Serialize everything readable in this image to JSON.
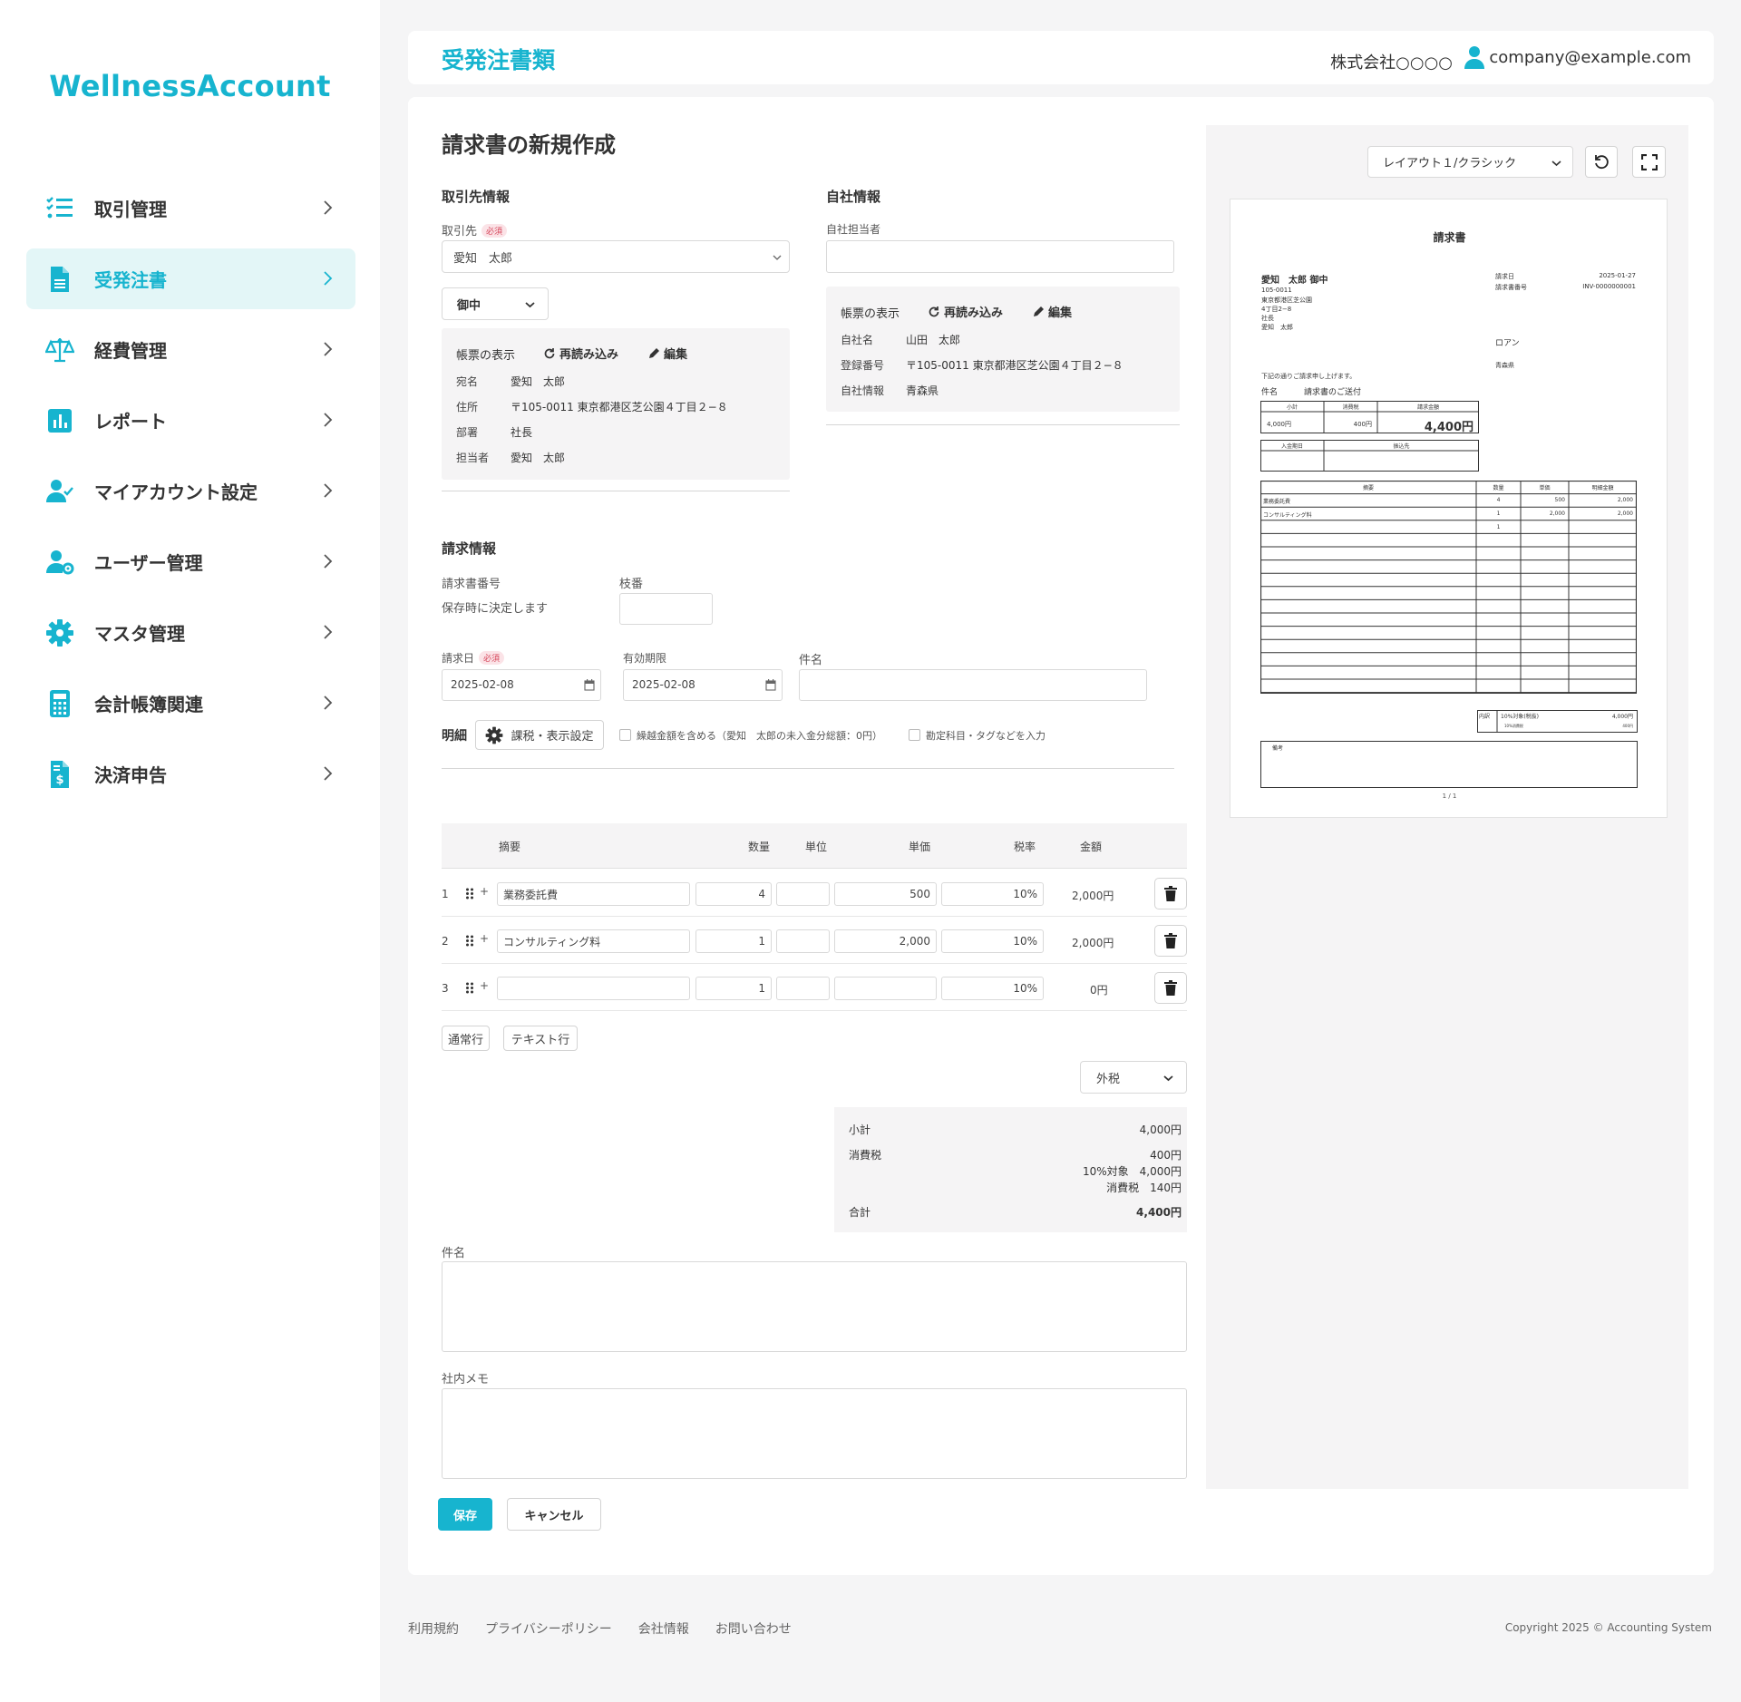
{
  "brand": {
    "name": "WellnessAccount",
    "accent": "#17b4cf"
  },
  "sidebar": {
    "items": [
      {
        "label": "取引管理",
        "icon": "list-check-icon",
        "active": false
      },
      {
        "label": "受発注書",
        "icon": "document-icon",
        "active": true
      },
      {
        "label": "経費管理",
        "icon": "scale-icon",
        "active": false
      },
      {
        "label": "レポート",
        "icon": "bar-chart-icon",
        "active": false
      },
      {
        "label": "マイアカウント設定",
        "icon": "user-check-icon",
        "active": false
      },
      {
        "label": "ユーザー管理",
        "icon": "user-gear-icon",
        "active": false
      },
      {
        "label": "マスタ管理",
        "icon": "gear-icon",
        "active": false
      },
      {
        "label": "会計帳簿関連",
        "icon": "calculator-icon",
        "active": false
      },
      {
        "label": "決済申告",
        "icon": "invoice-dollar-icon",
        "active": false
      }
    ]
  },
  "header": {
    "title": "受発注書類",
    "company": "株式会社○○○○",
    "email": "company@example.com"
  },
  "form": {
    "title": "請求書の新規作成",
    "client": {
      "section": "取引先情報",
      "label": "取引先",
      "required": "必須",
      "value": "愛知　太郎",
      "honorific": "御中",
      "display_label": "帳票の表示",
      "reload": "再読み込み",
      "edit": "編集",
      "rows": [
        {
          "k": "宛名",
          "v": "愛知　太郎"
        },
        {
          "k": "住所",
          "v": "〒105-0011 東京都港区芝公園４丁目２−８"
        },
        {
          "k": "部署",
          "v": "社長"
        },
        {
          "k": "担当者",
          "v": "愛知　太郎"
        }
      ]
    },
    "own": {
      "section": "自社情報",
      "staff_label": "自社担当者",
      "staff_value": "",
      "display_label": "帳票の表示",
      "reload": "再読み込み",
      "edit": "編集",
      "rows": [
        {
          "k": "自社名",
          "v": "山田　太郎"
        },
        {
          "k": "登録番号",
          "v": "〒105-0011 東京都港区芝公園４丁目２−８"
        },
        {
          "k": "自社情報",
          "v": "青森県"
        }
      ]
    },
    "billing": {
      "section": "請求情報",
      "number_label": "請求書番号",
      "number_note": "保存時に決定します",
      "branch_label": "枝番",
      "branch_value": "",
      "date_label": "請求日",
      "date_required": "必須",
      "date_value": "2025-02-08",
      "expiry_label": "有効期限",
      "expiry_value": "2025-02-08",
      "subject_label": "件名",
      "subject_value": ""
    },
    "details": {
      "label": "明細",
      "settings_button": "課税・表示設定",
      "carry_over": "繰越金額を含める（愛知　太郎の未入金分総額：0円）",
      "account_tags": "勘定科目・タグなどを入力",
      "columns": [
        "摘要",
        "数量",
        "単位",
        "単価",
        "税率",
        "金額"
      ],
      "rows": [
        {
          "no": "1",
          "desc": "業務委託費",
          "qty": "4",
          "unit": "",
          "price": "500",
          "tax": "10%",
          "amount": "2,000円"
        },
        {
          "no": "2",
          "desc": "コンサルティング料",
          "qty": "1",
          "unit": "",
          "price": "2,000",
          "tax": "10%",
          "amount": "2,000円"
        },
        {
          "no": "3",
          "desc": "",
          "qty": "1",
          "unit": "",
          "price": "",
          "tax": "10%",
          "amount": "0円"
        }
      ],
      "add_normal": "通常行",
      "add_text": "テキスト行",
      "tax_mode": "外税"
    },
    "summary": {
      "subtotal_label": "小計",
      "subtotal": "4,000円",
      "tax_label": "消費税",
      "tax": "400円",
      "tax_base": "10%対象　4,000円",
      "tax_detail": "消費税　140円",
      "total_label": "合計",
      "total": "4,400円"
    },
    "subject_label": "件名",
    "subject_value": "",
    "memo_label": "社内メモ",
    "memo_value": "",
    "save": "保存",
    "cancel": "キャンセル"
  },
  "preview": {
    "layout": "レイアウト１/クラシック",
    "doc": {
      "title": "請求書",
      "to": "愛知　太郎 御中",
      "zip": "105-0011",
      "addr1": "東京都港区芝公園",
      "addr2": "4丁目2−8",
      "dept": "社長",
      "person": "愛知　太郎",
      "date_label": "請求日",
      "date": "2025-01-27",
      "no_label": "請求書番号",
      "no": "INV-0000000001",
      "issuer": "ロアン",
      "issuer_pref": "青森県",
      "intro": "下記の通りご請求申し上げます。",
      "subject_label": "件名",
      "subject": "請求書のご送付",
      "box_subtotal": "小計",
      "box_tax": "消費税",
      "box_total": "請求金額",
      "subtotal": "4,000円",
      "tax": "400円",
      "total": "4,400円",
      "due_label": "入金期日",
      "bank_label": "振込先",
      "cols": [
        "摘要",
        "数量",
        "単価",
        "明細金額"
      ],
      "items": [
        {
          "desc": "業務委託費",
          "qty": "4",
          "price": "500",
          "amount": "2,000"
        },
        {
          "desc": "コンサルティング料",
          "qty": "1",
          "price": "2,000",
          "amount": "2,000"
        },
        {
          "desc": "",
          "qty": "1",
          "price": "",
          "amount": ""
        }
      ],
      "breakdown_label": "内訳",
      "breakdown_row": "10%対象(税抜)",
      "breakdown_amount": "4,000円",
      "breakdown_sub": "10%消費税",
      "breakdown_sub_amount": "400円",
      "remarks": "備考",
      "page": "1 / 1"
    }
  },
  "footer": {
    "links": [
      "利用規約",
      "プライバシーポリシー",
      "会社情報",
      "お問い合わせ"
    ],
    "copyright": "Copyright 2025 © Accounting System"
  }
}
